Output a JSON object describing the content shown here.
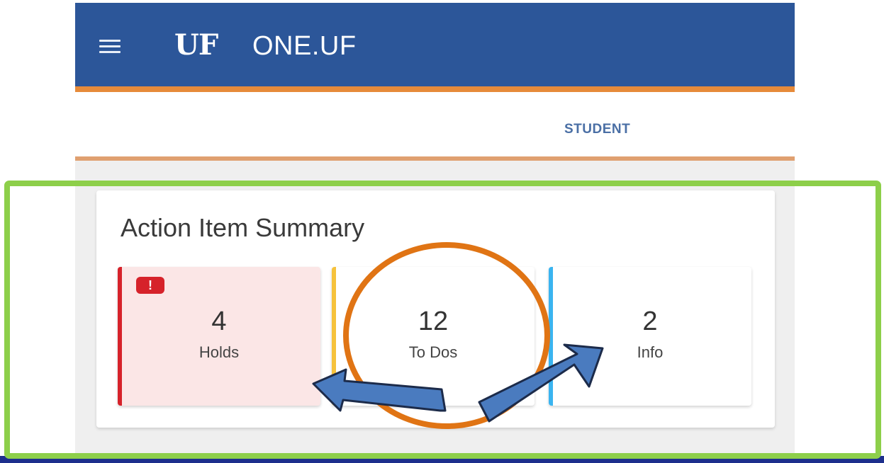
{
  "header": {
    "logo": "UF",
    "app_name": "ONE.UF"
  },
  "tabs": {
    "student": "STUDENT"
  },
  "summary": {
    "title": "Action Item Summary",
    "tiles": [
      {
        "count": "4",
        "label": "Holds",
        "alert_icon": "!"
      },
      {
        "count": "12",
        "label": "To Dos"
      },
      {
        "count": "2",
        "label": "Info"
      }
    ]
  },
  "colors": {
    "header": "#2c5699",
    "accent_orange": "#e68a3a",
    "holds": "#d6222a",
    "todos": "#f6c23c",
    "info": "#3ab4f0",
    "highlight_box": "#8dcf4a",
    "circle": "#e07414",
    "arrows": "#4a7bbf"
  },
  "icons": {
    "menu": "hamburger-menu-icon",
    "alert": "alert-icon"
  }
}
